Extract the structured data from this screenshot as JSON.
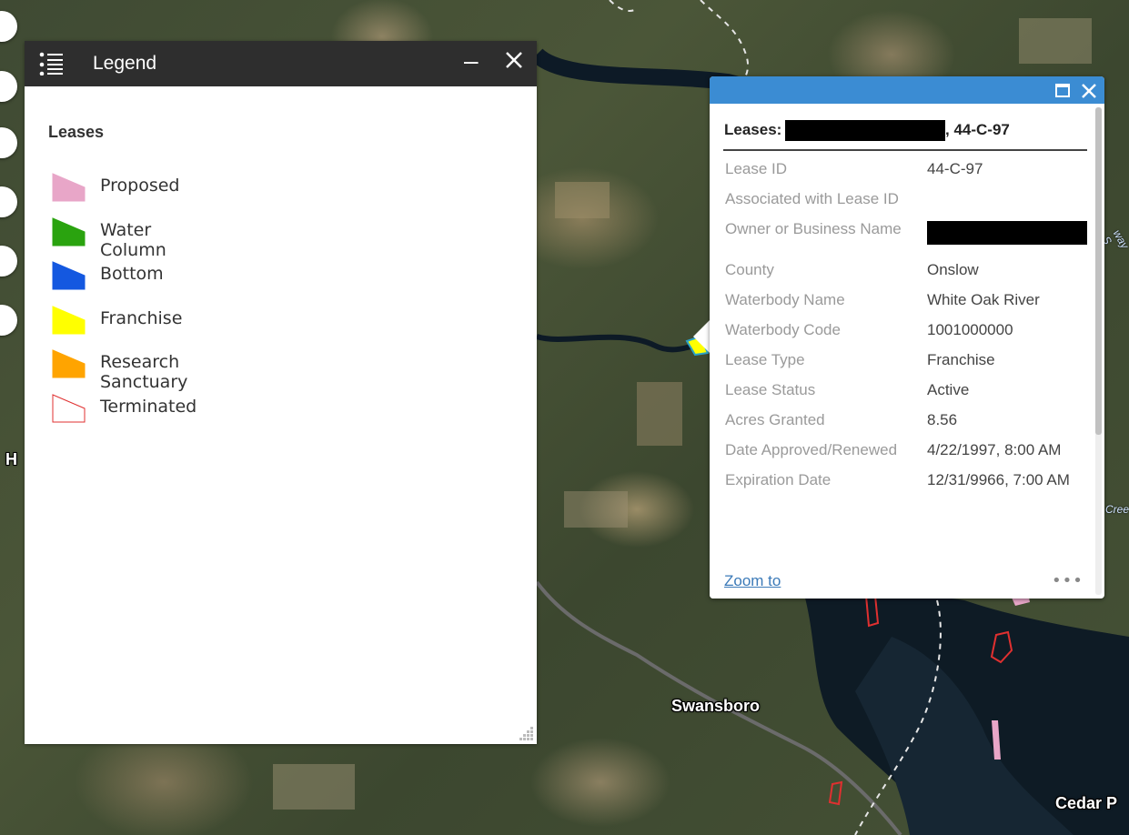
{
  "map": {
    "labels": {
      "town1": "Swansboro",
      "town2": "Cedar P",
      "left_edge": "H",
      "creek": "Cree",
      "road": "way S"
    },
    "colors": {
      "water": "#0d1a26",
      "river_line": "#e6e6e6"
    }
  },
  "legend": {
    "title": "Legend",
    "minimize_label": "–",
    "layer_title": "Leases",
    "items": [
      {
        "label": "Proposed",
        "color": "#e8a6c8",
        "stroke": "#e8a6c8"
      },
      {
        "label": "Water Column",
        "color": "#2aa30f",
        "stroke": "#2aa30f"
      },
      {
        "label": "Bottom",
        "color": "#1458e0",
        "stroke": "#1458e0"
      },
      {
        "label": "Franchise",
        "color": "#ffff00",
        "stroke": "#ffff00"
      },
      {
        "label": "Research Sanctuary",
        "color": "#ffa400",
        "stroke": "#ffa400"
      },
      {
        "label": "Terminated",
        "color": "#ffffff",
        "stroke": "#e03030"
      }
    ]
  },
  "popup": {
    "title_prefix": "Leases:",
    "title_suffix": ", 44-C-97",
    "fields": [
      {
        "key": "Lease ID",
        "value": "44-C-97"
      },
      {
        "key": "Associated with Lease ID",
        "value": ""
      },
      {
        "key": "Owner or Business Name",
        "value": "[redacted]"
      },
      {
        "key": "County",
        "value": "Onslow"
      },
      {
        "key": "Waterbody Name",
        "value": "White Oak River"
      },
      {
        "key": "Waterbody Code",
        "value": "1001000000"
      },
      {
        "key": "Lease Type",
        "value": "Franchise"
      },
      {
        "key": "Lease Status",
        "value": "Active"
      },
      {
        "key": "Acres Granted",
        "value": "8.56"
      },
      {
        "key": "Date Approved/Renewed",
        "value": "4/22/1997, 8:00 AM"
      },
      {
        "key": "Expiration Date",
        "value": "12/31/9966, 7:00 AM"
      }
    ],
    "zoom_label": "Zoom to",
    "more_label": "•••"
  }
}
